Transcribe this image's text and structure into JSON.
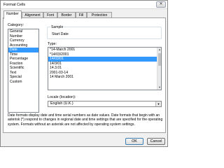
{
  "window": {
    "title": "Format Cells",
    "close_glyph": "✕"
  },
  "tabs": [
    "Number",
    "Alignment",
    "Font",
    "Border",
    "Fill",
    "Protection"
  ],
  "category": {
    "label": "Category:",
    "items": [
      "General",
      "Number",
      "Currency",
      "Accounting",
      "Date",
      "Time",
      "Percentage",
      "Fraction",
      "Scientific",
      "Text",
      "Special",
      "Custom"
    ],
    "selected": "Date"
  },
  "sample": {
    "label": "Sample",
    "value": "Start Date"
  },
  "type": {
    "label": "Type:",
    "items": [
      "*14-March 2001",
      "*14/03/2001",
      "14/03/01",
      "14/3/01",
      "14.3.01",
      "2001-03-14",
      "14 March 2001"
    ],
    "selected": "14/03/01"
  },
  "locale": {
    "label": "Locale (location):",
    "value": "English (U.K.)"
  },
  "description": "Date formats display date and time serial numbers as date values. Date formats that begin with an asterisk (*) respond to changes in regional date and time settings that are specified for the operating system. Formats without an asterisk are not affected by operating system settings.",
  "buttons": {
    "ok": "OK",
    "cancel": "Cancel"
  },
  "colors": {
    "selection": "#3399ff"
  }
}
